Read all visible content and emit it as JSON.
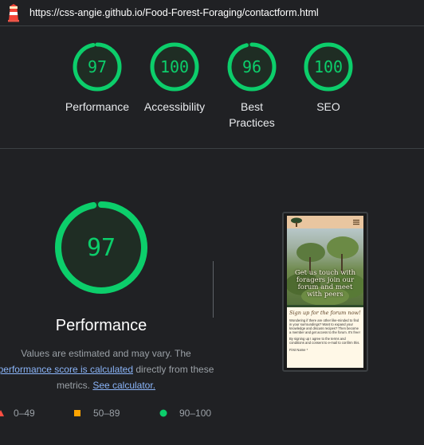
{
  "browser": {
    "url": "https://css-angie.github.io/Food-Forest-Foraging/contactform.html"
  },
  "colors": {
    "pass": "#0cce6b",
    "average": "#ffa400",
    "fail": "#ff4e42",
    "background": "#202124"
  },
  "gauges": [
    {
      "score": "97",
      "label": "Performance",
      "fraction": 0.97
    },
    {
      "score": "100",
      "label": "Accessibility",
      "fraction": 1.0
    },
    {
      "score": "96",
      "label": "Best Practices",
      "fraction": 0.96
    },
    {
      "score": "100",
      "label": "SEO",
      "fraction": 1.0
    }
  ],
  "performance": {
    "score": "97",
    "fraction": 0.97,
    "title": "Performance",
    "desc_prefix": "Values are estimated and may vary. The ",
    "desc_link": "performance score is calculated",
    "desc_middle": " directly from these metrics. ",
    "calc_link": "See calculator."
  },
  "legend": [
    {
      "range": "0–49",
      "shape": "triangle"
    },
    {
      "range": "50–89",
      "shape": "square"
    },
    {
      "range": "90–100",
      "shape": "circle"
    }
  ],
  "screenshot": {
    "hero_text": "Get us touch with foragers join our forum and meet with peers",
    "heading": "Sign up for the forum now!",
    "paragraph1": "Wondering if there are other like-minded to find in your surroundings? Want to expand your knowledge and discuss recipes? Then become a member and get access to the forum. It's free!",
    "paragraph2": "By signing up I agree to the terms and conditions and consent to e-mail to confirm this.",
    "field_label": "First Name *"
  }
}
